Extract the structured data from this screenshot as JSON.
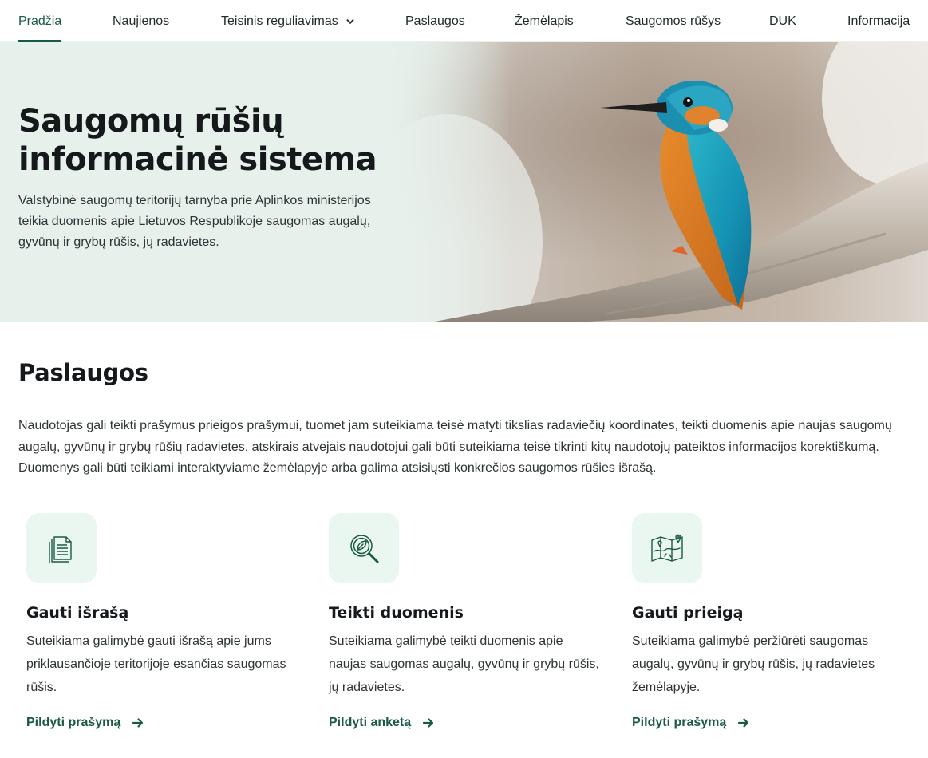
{
  "nav": {
    "items": [
      {
        "label": "Pradžia",
        "active": true
      },
      {
        "label": "Naujienos"
      },
      {
        "label": "Teisinis reguliavimas",
        "has_dropdown": true
      },
      {
        "label": "Paslaugos"
      },
      {
        "label": "Žemėlapis"
      },
      {
        "label": "Saugomos rūšys"
      },
      {
        "label": "DUK"
      },
      {
        "label": "Informacija"
      }
    ]
  },
  "hero": {
    "title_line1": "Saugomų rūšių",
    "title_line2": "informacinė sistema",
    "description": "Valstybinė saugomų teritorijų tarnyba prie Aplinkos ministerijos teikia duomenis apie Lietuvos Respublikoje saugomas augalų, gyvūnų ir grybų rūšis, jų radavietes.",
    "image": "kingfisher-on-branch"
  },
  "services": {
    "title": "Paslaugos",
    "description": "Naudotojas gali teikti prašymus prieigos prašymui, tuomet jam suteikiama teisė matyti tikslias radaviečių koordinates, teikti duomenis apie naujas saugomų augalų, gyvūnų ir grybų rūšių radavietes, atskirais atvejais naudotojui gali būti suteikiama teisė tikrinti kitų naudotojų pateiktos informacijos korektiškumą. Duomenys gali būti teikiami interaktyviame žemėlapyje arba galima atsisiųsti konkrečios saugomos rūšies išrašą.",
    "cards": [
      {
        "icon": "documents-icon",
        "title": "Gauti išrašą",
        "description": "Suteikiama galimybė gauti išrašą apie jums priklausančioje teritorijoje esančias saugomas rūšis.",
        "link": "Pildyti prašymą"
      },
      {
        "icon": "leaf-search-icon",
        "title": "Teikti duomenis",
        "description": "Suteikiama galimybė teikti duomenis apie naujas saugomas augalų, gyvūnų ir grybų rūšis, jų radavietes.",
        "link": "Pildyti anketą"
      },
      {
        "icon": "map-pins-icon",
        "title": "Gauti prieigą",
        "description": "Suteikiama galimybė peržiūrėti saugomas augalų, gyvūnų ir grybų rūšis, jų radavietes žemėlapyje.",
        "link": "Pildyti prašymą"
      }
    ]
  },
  "colors": {
    "brand": "#1a5a44",
    "icon_bg": "#eaf6f0",
    "hero_bg": "#e6f1ec"
  }
}
